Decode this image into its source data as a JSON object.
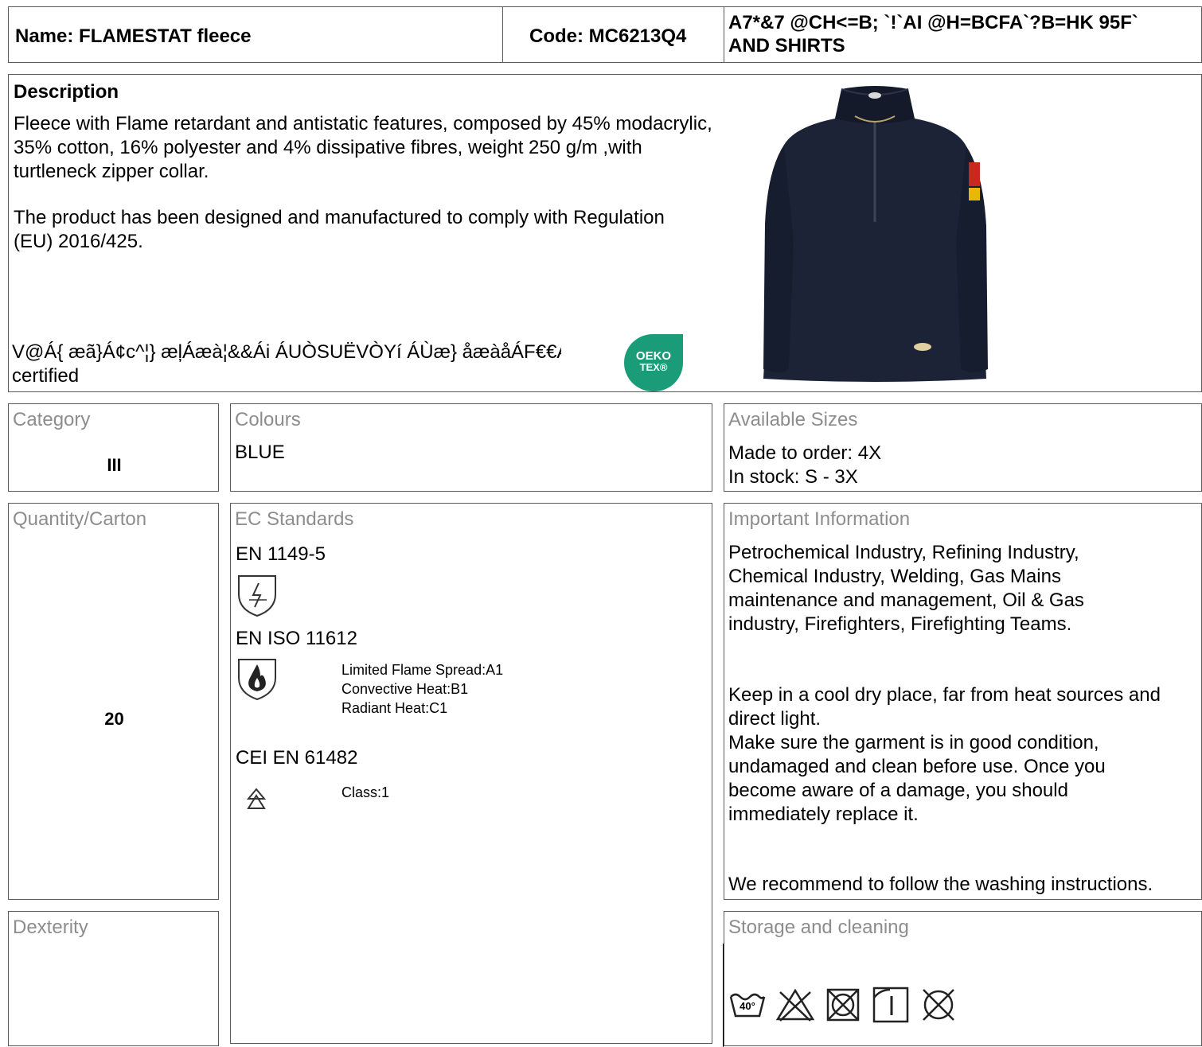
{
  "header": {
    "name": "Name: FLAMESTAT fleece",
    "code": "Code: MC6213Q4",
    "category_line1": "A7*&7 @CH<=B; `!`AI @H=BCFA`?B=HK 95F`",
    "category_line2": "AND SHIRTS"
  },
  "description": {
    "title": "Description",
    "paragraph1": "Fleece with Flame retardant and antistatic features, composed by 45% modacrylic, 35% cotton, 16% polyester and 4% dissipative fibres, weight 250 g/m ,with turtleneck zipper collar.",
    "paragraph2": "The product has been designed and manufactured to comply with Regulation (EU) 2016/425.",
    "certification_garbled": "V@Á{ æã}Á¢c^¦} æļÁæà¦&&Ái ÁUÒSUËVÒYí ÁÙæ} åæàåÁF€€Á",
    "certification_tail": "certified",
    "oeko_badge_line1": "OEKO",
    "oeko_badge_line2": "TEX®"
  },
  "category": {
    "label": "Category",
    "value": "III"
  },
  "colours": {
    "label": "Colours",
    "value": "BLUE"
  },
  "sizes": {
    "label": "Available Sizes",
    "line1": "Made to order: 4X",
    "line2": "In stock: S - 3X"
  },
  "quantity": {
    "label": "Quantity/Carton",
    "value": "20"
  },
  "standards": {
    "label": "EC Standards",
    "items": [
      {
        "name": "EN 1149-5",
        "icon": "antistatic-shield-icon",
        "details": []
      },
      {
        "name": "EN ISO 11612",
        "icon": "flame-shield-icon",
        "details": [
          "Limited Flame Spread:A1",
          "Convective Heat:B1",
          "Radiant Heat:C1"
        ]
      },
      {
        "name": "CEI EN 61482",
        "icon": "arc-flash-icon",
        "details": [
          "Class:1"
        ]
      }
    ]
  },
  "important": {
    "label": "Important Information",
    "para1": "Petrochemical Industry, Refining Industry, Chemical Industry, Welding, Gas Mains maintenance and management, Oil & Gas industry, Firefighters, Firefighting Teams.",
    "para2": "Keep in a cool dry place, far from heat sources and direct light.",
    "para3": "Make sure the garment is in good condition, undamaged and clean before use. Once you become aware of a damage, you should immediately replace it.",
    "para4": "We recommend to follow the washing instructions."
  },
  "dexterity": {
    "label": "Dexterity"
  },
  "storage": {
    "label": "Storage and cleaning",
    "wash_temp": "40°",
    "icons": [
      "wash-40-icon",
      "no-bleach-icon",
      "no-tumble-dry-icon",
      "iron-low-icon",
      "no-dry-clean-icon"
    ]
  },
  "colors": {
    "border": "#5a5a5a",
    "label_grey": "#8d8d8d",
    "oeko_green": "#1a9c78",
    "jacket_navy": "#1c2336"
  }
}
